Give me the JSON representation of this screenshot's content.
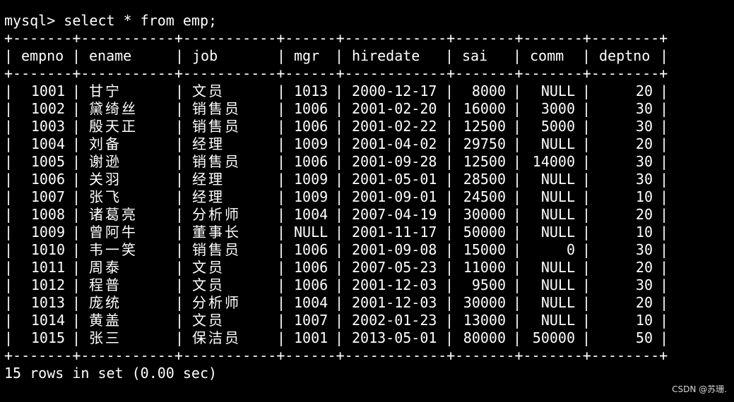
{
  "prompt": "mysql>",
  "command": "select * from emp;",
  "border": "+-------+-----------+-----------+------+------------+-------+-------+--------+",
  "headers": [
    "empno",
    "ename",
    "job",
    "mgr",
    "hiredate",
    "sai",
    "comm",
    "deptno"
  ],
  "rows": [
    [
      "1001",
      "甘宁",
      "文员",
      "1013",
      "2000-12-17",
      "8000",
      "NULL",
      "20"
    ],
    [
      "1002",
      "黛绮丝",
      "销售员",
      "1006",
      "2001-02-20",
      "16000",
      "3000",
      "30"
    ],
    [
      "1003",
      "殷天正",
      "销售员",
      "1006",
      "2001-02-22",
      "12500",
      "5000",
      "30"
    ],
    [
      "1004",
      "刘备",
      "经理",
      "1009",
      "2001-04-02",
      "29750",
      "NULL",
      "20"
    ],
    [
      "1005",
      "谢逊",
      "销售员",
      "1006",
      "2001-09-28",
      "12500",
      "14000",
      "30"
    ],
    [
      "1006",
      "关羽",
      "经理",
      "1009",
      "2001-05-01",
      "28500",
      "NULL",
      "30"
    ],
    [
      "1007",
      "张飞",
      "经理",
      "1009",
      "2001-09-01",
      "24500",
      "NULL",
      "10"
    ],
    [
      "1008",
      "诸葛亮",
      "分析师",
      "1004",
      "2007-04-19",
      "30000",
      "NULL",
      "20"
    ],
    [
      "1009",
      "曾阿牛",
      "董事长",
      "NULL",
      "2001-11-17",
      "50000",
      "NULL",
      "10"
    ],
    [
      "1010",
      "韦一笑",
      "销售员",
      "1006",
      "2001-09-08",
      "15000",
      "0",
      "30"
    ],
    [
      "1011",
      "周泰",
      "文员",
      "1006",
      "2007-05-23",
      "11000",
      "NULL",
      "20"
    ],
    [
      "1012",
      "程普",
      "文员",
      "1006",
      "2001-12-03",
      "9500",
      "NULL",
      "30"
    ],
    [
      "1013",
      "庞统",
      "分析师",
      "1004",
      "2001-12-03",
      "30000",
      "NULL",
      "20"
    ],
    [
      "1014",
      "黄盖",
      "文员",
      "1007",
      "2002-01-23",
      "13000",
      "NULL",
      "10"
    ],
    [
      "1015",
      "张三",
      "保洁员",
      "1001",
      "2013-05-01",
      "80000",
      "50000",
      "50"
    ]
  ],
  "footer": "15 rows in set (0.00 sec)",
  "watermark": "CSDN @苏珊."
}
